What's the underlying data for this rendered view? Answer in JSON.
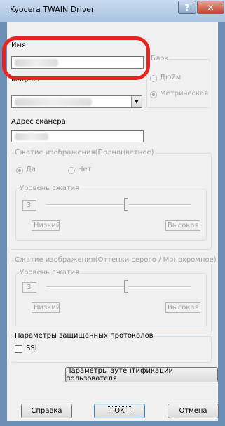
{
  "window": {
    "title": "Kyocera TWAIN Driver",
    "help_glyph": "?",
    "close_glyph": "✕"
  },
  "name": {
    "label": "Имя",
    "value": ""
  },
  "model": {
    "label": "Модель",
    "value": ""
  },
  "unit": {
    "title": "Блок",
    "options": [
      {
        "label": "Дюйм",
        "selected": false
      },
      {
        "label": "Метрическая",
        "selected": true
      }
    ]
  },
  "scanner_address": {
    "label": "Адрес сканера",
    "value": ""
  },
  "color_compression": {
    "title": "Сжатие изображения(Полноцветное)",
    "yes_label": "Да",
    "no_label": "Нет",
    "level_title": "Уровень сжатия",
    "level_value": "3",
    "low_label": "Низкий",
    "high_label": "Высокая"
  },
  "gray_compression": {
    "title": "Сжатие изображения(Оттенки серого / Монохромное)",
    "level_title": "Уровень сжатия",
    "level_value": "3",
    "low_label": "Низкий",
    "high_label": "Высокая"
  },
  "secure": {
    "title": "Параметры защищенных протоколов",
    "ssl_label": "SSL",
    "ssl_checked": false
  },
  "buttons": {
    "auth": "Параметры аутентификации пользователя",
    "help": "Справка",
    "ok": "OK",
    "cancel": "Отмена"
  },
  "colors": {
    "highlight": "#e8231d",
    "titlebar": "#b8cde6"
  }
}
